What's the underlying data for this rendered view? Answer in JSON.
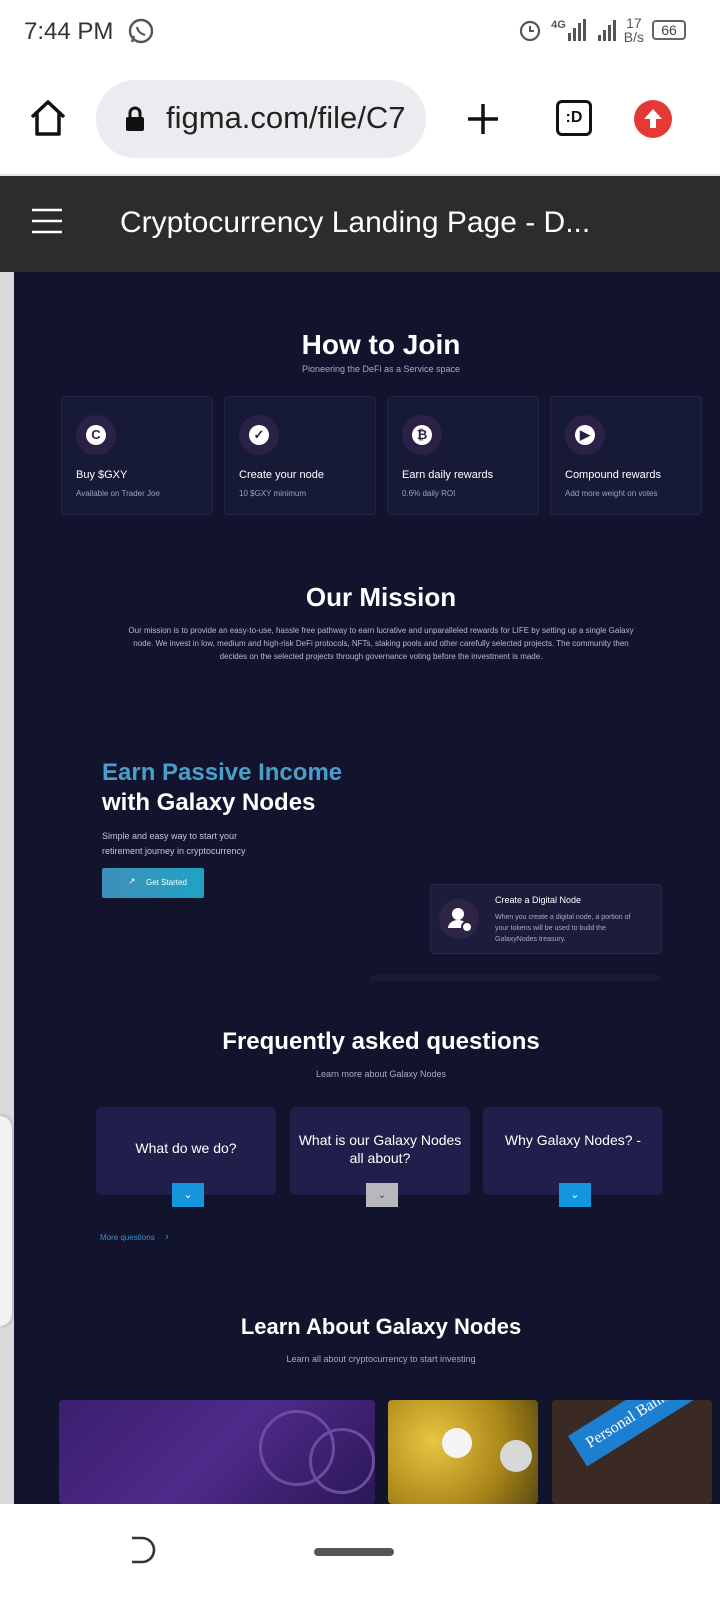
{
  "status_bar": {
    "time": "7:44 PM",
    "network": "4G",
    "speed_value": "17",
    "speed_unit": "B/s",
    "battery": "66"
  },
  "browser": {
    "url": "figma.com/file/C7",
    "tab_count": ":D"
  },
  "figma": {
    "file_title": "Cryptocurrency Landing Page - D..."
  },
  "how_to_join": {
    "title": "How to Join",
    "subtitle": "Pioneering the DeFi as a Service space",
    "cards": [
      {
        "icon": "c-coin-icon",
        "glyph": "C",
        "title": "Buy $GXY",
        "subtitle": "Available on Trader Joe"
      },
      {
        "icon": "shield-check-icon",
        "glyph": "✓",
        "title": "Create your node",
        "subtitle": "10 $GXY minimum"
      },
      {
        "icon": "bitcoin-icon",
        "glyph": "₿",
        "title": "Earn daily rewards",
        "subtitle": "0.6% daily ROI"
      },
      {
        "icon": "document-play-icon",
        "glyph": "▶",
        "title": "Compound rewards",
        "subtitle": "Add more weight on votes"
      }
    ]
  },
  "mission": {
    "title": "Our Mission",
    "text": "Our mission is to provide an easy-to-use, hassle free pathway to earn lucrative and unparalleled rewards for LIFE by setting up a single Galaxy node. We invest in low, medium and high-risk DeFi protocols, NFTs, staking pools and other carefully selected projects. The community then decides on the selected projects through governance voting before the investment is made."
  },
  "hero": {
    "title_line1": "Earn Passive Income",
    "title_line2": "with Galaxy Nodes",
    "subtitle_line1": "Simple and easy way to start your",
    "subtitle_line2": "retirement journey in cryptocurrency",
    "cta_label": "Get Started",
    "node_card_title": "Create a Digital Node",
    "node_card_text": "When you create a digital node, a portion of your tokens will be used to build the GalaxyNodes treasury."
  },
  "faq": {
    "title": "Frequently asked questions",
    "subtitle": "Learn more about Galaxy Nodes",
    "items": [
      {
        "question": "What do we do?"
      },
      {
        "question": "What is our Galaxy Nodes all about?"
      },
      {
        "question": "Why Galaxy Nodes? -"
      }
    ],
    "more_label": "More questions"
  },
  "learn": {
    "title": "Learn About Galaxy Nodes",
    "subtitle": "Learn all about cryptocurrency to start investing",
    "banner_text": "Personal Banking"
  },
  "colors": {
    "page_bg": "#12132d",
    "accent_blue": "#1596dc",
    "hero_gradient": "#4a9fc8",
    "figma_bar": "#2c2c2c"
  }
}
